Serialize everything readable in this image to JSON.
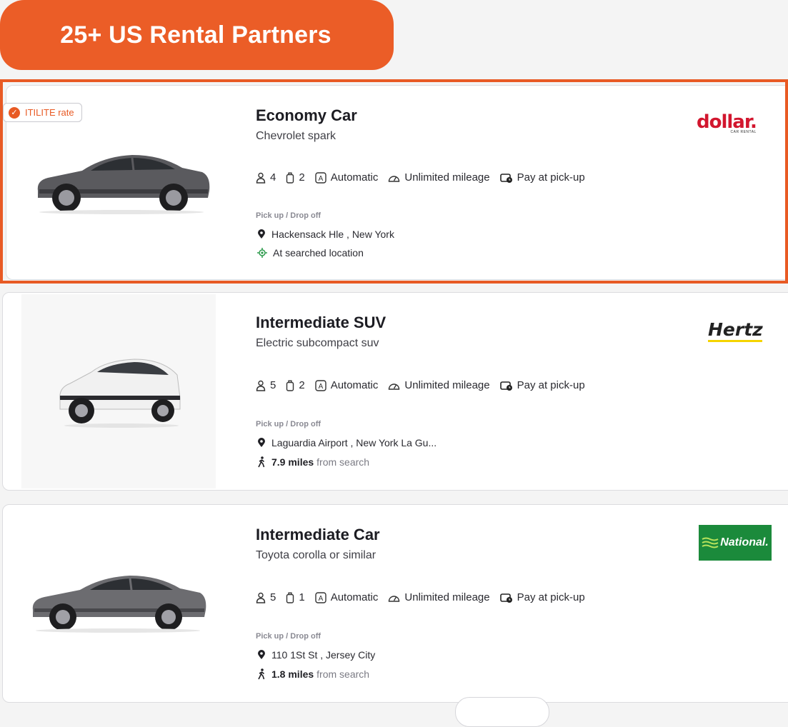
{
  "banner": {
    "text": "25+ US Rental Partners"
  },
  "colors": {
    "accent": "#e85a24",
    "banner_bg": "#eb5d27",
    "dollar_red": "#d2162e",
    "hertz_yellow": "#f5d400",
    "national_green": "#1b8a3b"
  },
  "listings": [
    {
      "badge": "ITILITE rate",
      "title": "Economy Car",
      "subtitle": "Chevrolet spark",
      "passengers": "4",
      "bags": "2",
      "transmission": "Automatic",
      "mileage": "Unlimited mileage",
      "payment": "Pay at pick-up",
      "pickup_label": "Pick up / Drop off",
      "location": "Hackensack Hle , New York",
      "distance_text": "At searched location",
      "vendor": {
        "name": "dollar.",
        "tagline": "CAR RENTAL"
      }
    },
    {
      "title": "Intermediate SUV",
      "subtitle": "Electric subcompact suv",
      "passengers": "5",
      "bags": "2",
      "transmission": "Automatic",
      "mileage": "Unlimited mileage",
      "payment": "Pay at pick-up",
      "pickup_label": "Pick up / Drop off",
      "location": "Laguardia Airport , New York La Gu...",
      "distance_value": "7.9 miles",
      "distance_suffix": "from search",
      "vendor": {
        "name": "Hertz"
      }
    },
    {
      "title": "Intermediate Car",
      "subtitle": "Toyota corolla or similar",
      "passengers": "5",
      "bags": "1",
      "transmission": "Automatic",
      "mileage": "Unlimited mileage",
      "payment": "Pay at pick-up",
      "pickup_label": "Pick up / Drop off",
      "location": "110 1St St , Jersey City",
      "distance_value": "1.8 miles",
      "distance_suffix": "from search",
      "vendor": {
        "name": "National."
      }
    }
  ],
  "icons": [
    "person-icon",
    "luggage-icon",
    "automatic-icon",
    "speedometer-icon",
    "wallet-clock-icon",
    "location-pin-icon",
    "target-icon",
    "walking-icon"
  ]
}
